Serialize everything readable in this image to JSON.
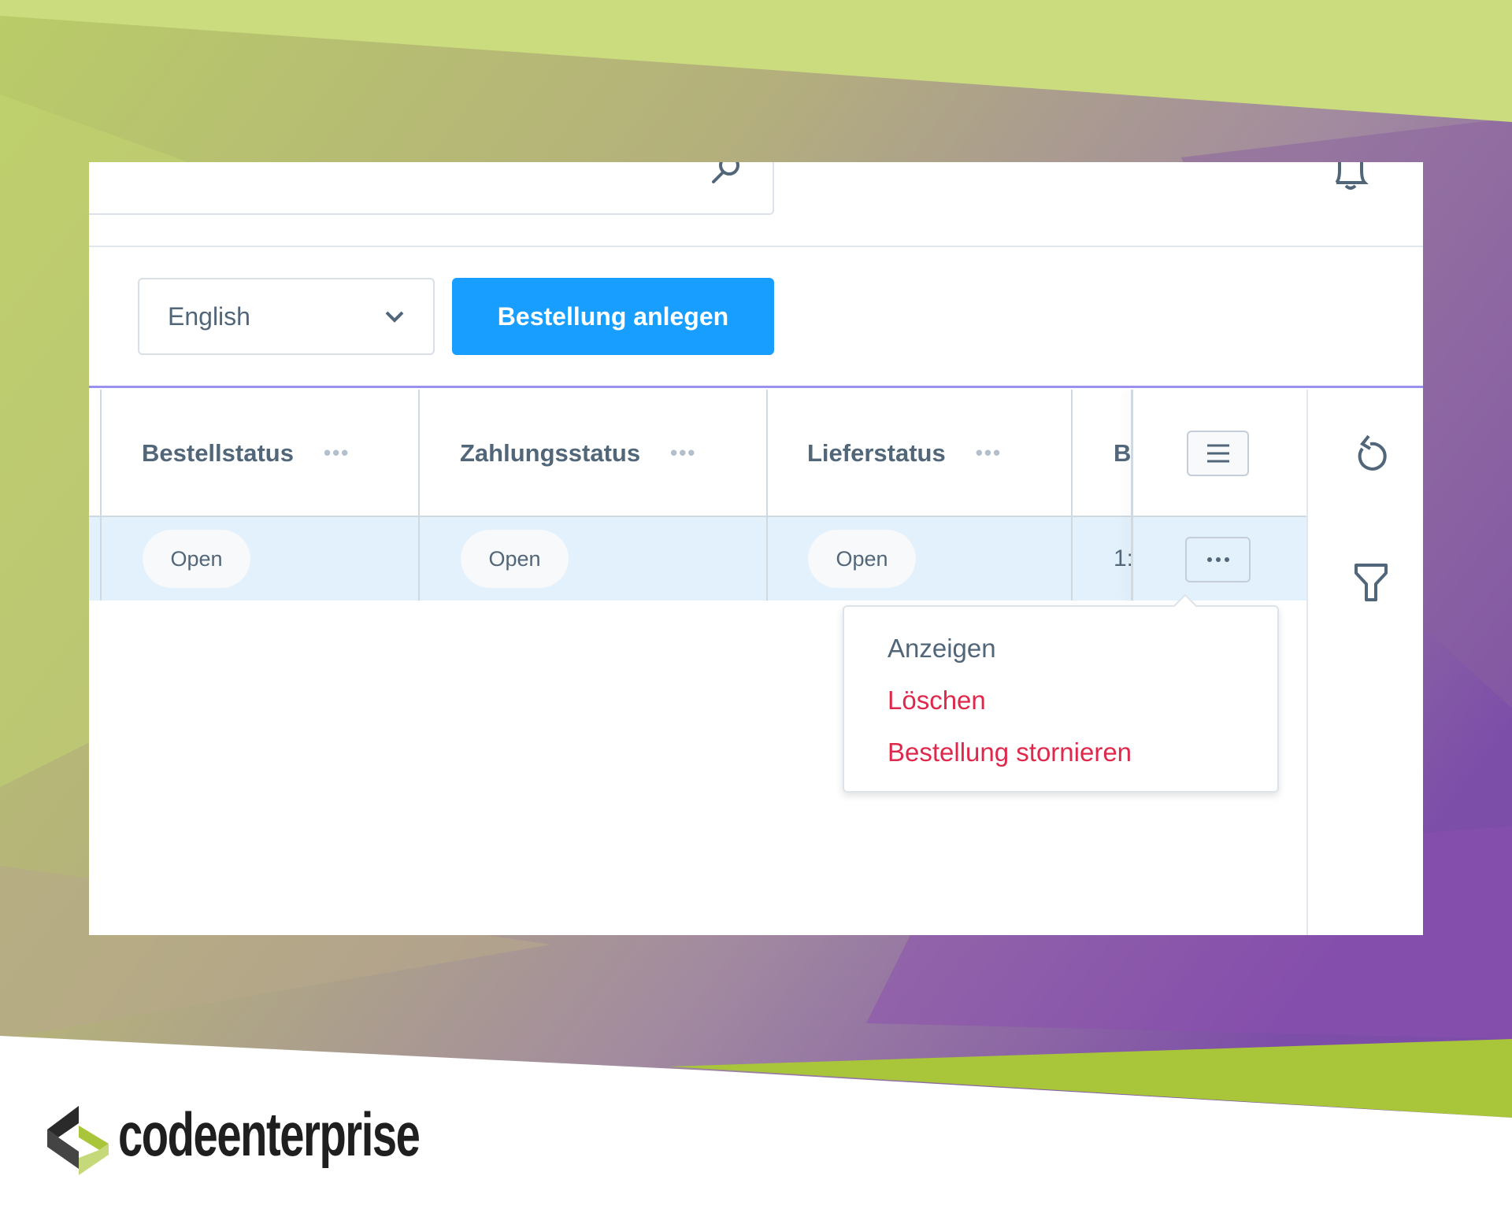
{
  "header": {
    "search_icon": "search-icon",
    "bell_icon": "bell-icon"
  },
  "toolbar": {
    "language_select": "English",
    "create_button": "Bestellung anlegen"
  },
  "table": {
    "columns": [
      {
        "label": "Bestellstatus",
        "menu": "•••"
      },
      {
        "label": "Zahlungsstatus",
        "menu": "•••"
      },
      {
        "label": "Lieferstatus",
        "menu": "•••"
      },
      {
        "label": "B"
      }
    ],
    "rows": [
      {
        "cells": [
          "Open",
          "Open",
          "Open",
          "1:"
        ]
      }
    ]
  },
  "context_menu": {
    "items": [
      {
        "label": "Anzeigen",
        "color": "#52667a"
      },
      {
        "label": "Löschen",
        "color": "#de294c"
      },
      {
        "label": "Bestellung stornieren",
        "color": "#de294c"
      }
    ]
  },
  "side_actions": {
    "refresh_icon": "rotate-ccw-icon",
    "filter_icon": "filter-icon"
  },
  "brand": {
    "name": "codeenterprise"
  },
  "colors": {
    "primary": "#189eff",
    "accent_line": "#9b8ff0",
    "danger": "#de294c",
    "row_selected": "#e3f1fd"
  }
}
